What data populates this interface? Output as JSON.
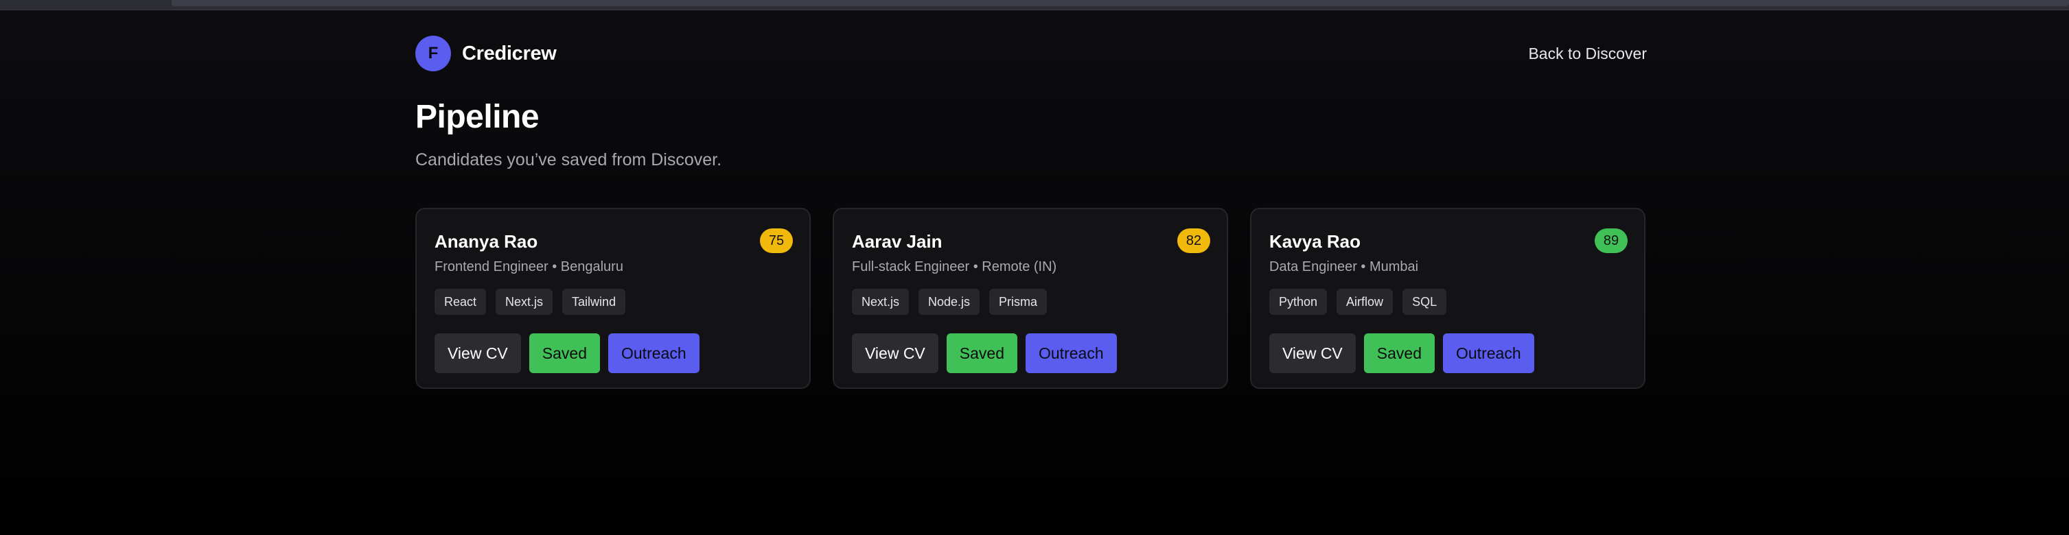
{
  "app": {
    "logo_letter": "F",
    "brand_name": "Credicrew",
    "back_link": "Back to Discover"
  },
  "page": {
    "title": "Pipeline",
    "subtitle": "Candidates you’ve saved from Discover."
  },
  "colors": {
    "accent": "#5b5cf0",
    "saved": "#3fc157",
    "score_yellow": "#f0b90b",
    "score_green": "#3fc157"
  },
  "candidates": [
    {
      "name": "Ananya Rao",
      "score": "75",
      "score_color": "#f0b90b",
      "role": "Frontend Engineer • Bengaluru",
      "tags": [
        "React",
        "Next.js",
        "Tailwind"
      ],
      "actions": {
        "view": "View CV",
        "saved": "Saved",
        "outreach": "Outreach"
      }
    },
    {
      "name": "Aarav Jain",
      "score": "82",
      "score_color": "#f0b90b",
      "role": "Full-stack Engineer • Remote (IN)",
      "tags": [
        "Next.js",
        "Node.js",
        "Prisma"
      ],
      "actions": {
        "view": "View CV",
        "saved": "Saved",
        "outreach": "Outreach"
      }
    },
    {
      "name": "Kavya Rao",
      "score": "89",
      "score_color": "#3fc157",
      "role": "Data Engineer • Mumbai",
      "tags": [
        "Python",
        "Airflow",
        "SQL"
      ],
      "actions": {
        "view": "View CV",
        "saved": "Saved",
        "outreach": "Outreach"
      }
    }
  ]
}
